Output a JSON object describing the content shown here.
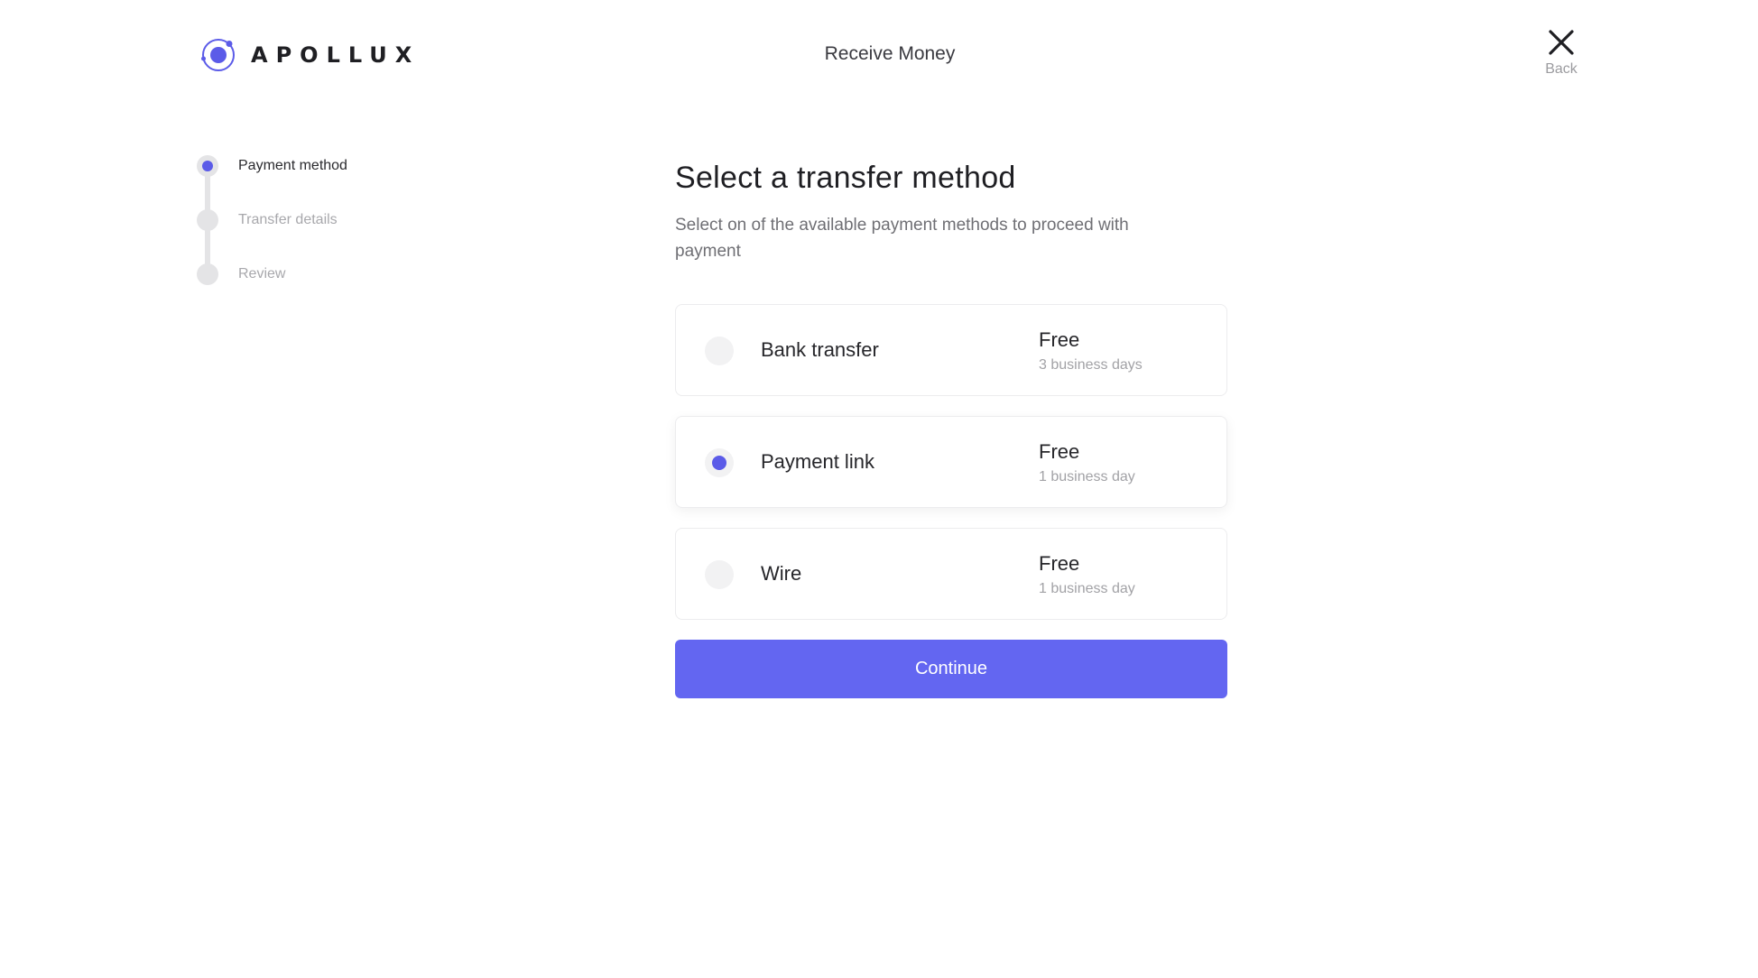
{
  "header": {
    "brand": "APOLLUX",
    "title": "Receive Money",
    "back_label": "Back"
  },
  "colors": {
    "accent": "#6366f1",
    "radio_selected": "#5b5be8",
    "muted_text": "#a2a2a6"
  },
  "stepper": {
    "steps": [
      {
        "label": "Payment method",
        "state": "active"
      },
      {
        "label": "Transfer details",
        "state": "pending"
      },
      {
        "label": "Review",
        "state": "pending"
      }
    ]
  },
  "main": {
    "title": "Select a transfer method",
    "subtitle": "Select on of the available payment methods to proceed with payment",
    "options": [
      {
        "name": "Bank transfer",
        "fee": "Free",
        "time": "3 business days",
        "selected": false
      },
      {
        "name": "Payment link",
        "fee": "Free",
        "time": "1 business day",
        "selected": true
      },
      {
        "name": "Wire",
        "fee": "Free",
        "time": "1 business day",
        "selected": false
      }
    ],
    "continue_label": "Continue"
  }
}
